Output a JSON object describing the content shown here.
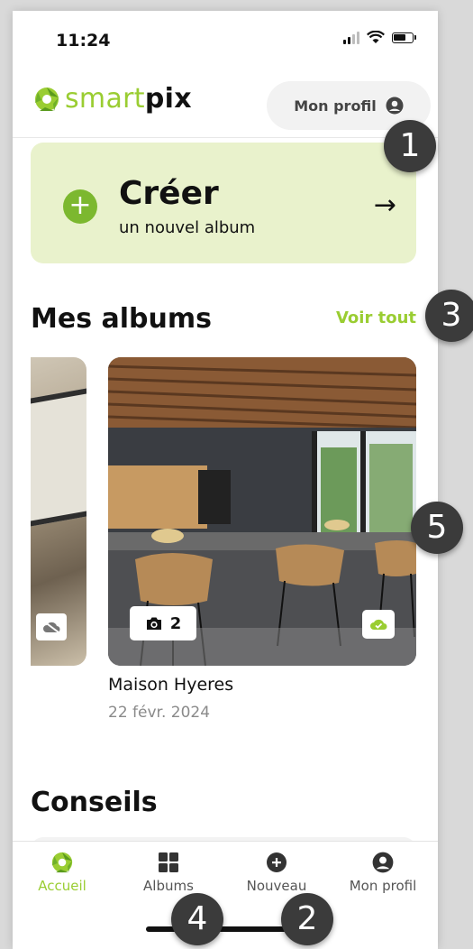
{
  "status": {
    "time": "11:24"
  },
  "header": {
    "logo_light": "smart",
    "logo_bold": "pix",
    "profile_button": "Mon profil"
  },
  "create": {
    "title": "Créer",
    "subtitle": "un nouvel album",
    "arrow": "→"
  },
  "albums": {
    "title": "Mes albums",
    "see_all": "Voir tout",
    "items": [
      {
        "name": "Maison Hyeres",
        "date": "22 févr. 2024",
        "photo_count": "2"
      }
    ]
  },
  "tips": {
    "title": "Conseils"
  },
  "tabbar": {
    "items": [
      {
        "label": "Accueil",
        "icon": "home-aperture-icon",
        "active": true
      },
      {
        "label": "Albums",
        "icon": "grid-icon"
      },
      {
        "label": "Nouveau",
        "icon": "plus-circle-icon"
      },
      {
        "label": "Mon profil",
        "icon": "user-circle-icon"
      }
    ]
  },
  "markers": [
    "1",
    "2",
    "3",
    "4",
    "5"
  ],
  "colors": {
    "accent": "#9acd32",
    "card_bg": "#e9f2cc",
    "plus": "#7cb82f",
    "marker": "#3b3b3b"
  }
}
